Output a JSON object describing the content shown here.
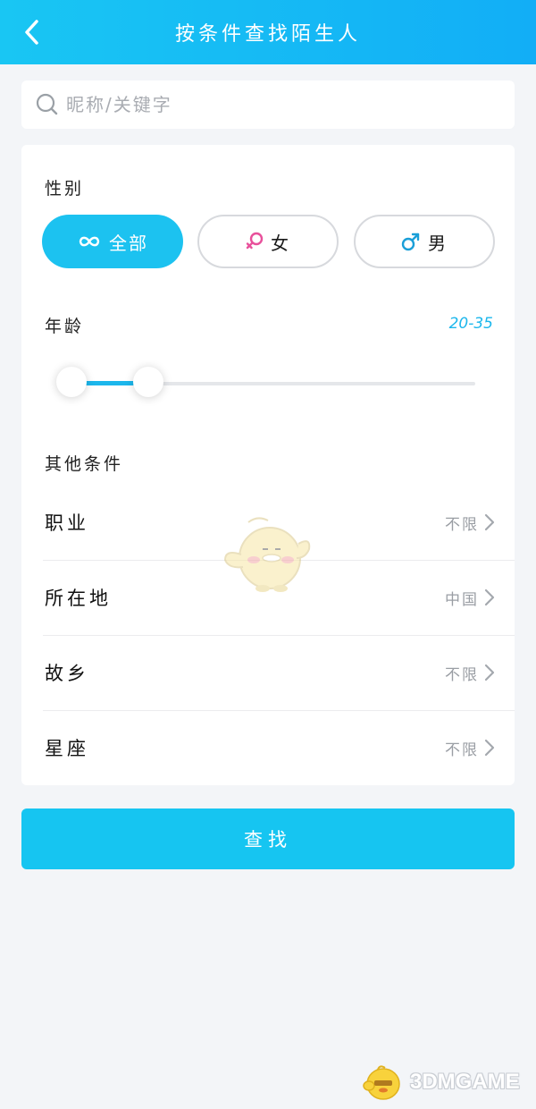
{
  "header": {
    "title": "按条件查找陌生人",
    "back_icon": "chevron-left-icon"
  },
  "search": {
    "placeholder": "昵称/关键字",
    "icon": "search-icon"
  },
  "gender": {
    "label": "性别",
    "options": [
      {
        "label": "全部",
        "icon": "infinity-icon",
        "selected": true
      },
      {
        "label": "女",
        "icon": "female-icon",
        "selected": false
      },
      {
        "label": "男",
        "icon": "male-icon",
        "selected": false
      }
    ]
  },
  "age": {
    "label": "年龄",
    "range_text": "20-35",
    "min": 20,
    "max": 35
  },
  "other": {
    "label": "其他条件",
    "rows": [
      {
        "label": "职业",
        "value": "不限"
      },
      {
        "label": "所在地",
        "value": "中国"
      },
      {
        "label": "故乡",
        "value": "不限"
      },
      {
        "label": "星座",
        "value": "不限"
      }
    ]
  },
  "submit": {
    "label": "查找"
  },
  "watermark": {
    "text": "3DMGAME"
  },
  "colors": {
    "accent": "#1cc2f0",
    "header_gradient_start": "#19c6f3",
    "header_gradient_end": "#12aef6",
    "female": "#e8509b",
    "male": "#1a9fd8",
    "background": "#f3f5f8"
  }
}
